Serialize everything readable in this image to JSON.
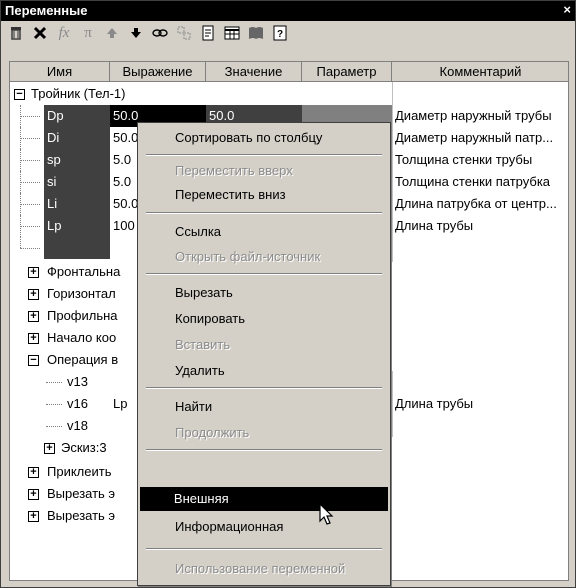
{
  "window": {
    "title": "Переменные",
    "close_label": "×"
  },
  "toolbar": {
    "icons": [
      "delete-icon",
      "fx-icon",
      "pi-icon",
      "up-arrow-icon",
      "down-arrow-icon",
      "link-icon",
      "source-file-icon",
      "properties-icon",
      "table-icon",
      "book-icon",
      "help-icon"
    ]
  },
  "columns": [
    "Имя",
    "Выражение",
    "Значение",
    "Параметр",
    "Комментарий"
  ],
  "tree": {
    "root_label": "Тройник (Тел-1)",
    "vars": [
      {
        "name": "Dp",
        "expr": "50.0",
        "value": "50.0",
        "comment": "Диаметр наружный трубы"
      },
      {
        "name": "Di",
        "expr": "50.0",
        "value": "",
        "comment": "Диаметр наружный патр..."
      },
      {
        "name": "sp",
        "expr": "5.0",
        "value": "",
        "comment": "Толщина стенки трубы"
      },
      {
        "name": "si",
        "expr": "5.0",
        "value": "",
        "comment": "Толщина стенки патрубка"
      },
      {
        "name": "Li",
        "expr": "50.0",
        "value": "",
        "comment": "Длина патрубка от центр..."
      },
      {
        "name": "Lp",
        "expr": "100",
        "value": "",
        "comment": "Длина трубы"
      }
    ],
    "groups": [
      "Фронтальна",
      "Горизонтал",
      "Профильна",
      "Начало коо",
      "Операция в"
    ],
    "sub_vars": [
      {
        "name": "v13",
        "expr": "",
        "comment": ""
      },
      {
        "name": "v16",
        "expr": "Lp",
        "comment": "Длина трубы"
      },
      {
        "name": "v18",
        "expr": "",
        "comment": ""
      }
    ],
    "sketch": "Эскиз:3",
    "bottom_groups": [
      "Приклеить",
      "Вырезать э",
      "Вырезать э"
    ]
  },
  "menu": {
    "sort": "Сортировать по столбцу",
    "move_up": "Переместить вверх",
    "move_down": "Переместить вниз",
    "link": "Ссылка",
    "open_source": "Открыть файл-источник",
    "cut": "Вырезать",
    "copy": "Копировать",
    "paste": "Вставить",
    "delete": "Удалить",
    "find": "Найти",
    "continue": "Продолжить",
    "external": "Внешняя",
    "info": "Информационная",
    "usage": "Использование переменной",
    "check_mark": "✓"
  }
}
